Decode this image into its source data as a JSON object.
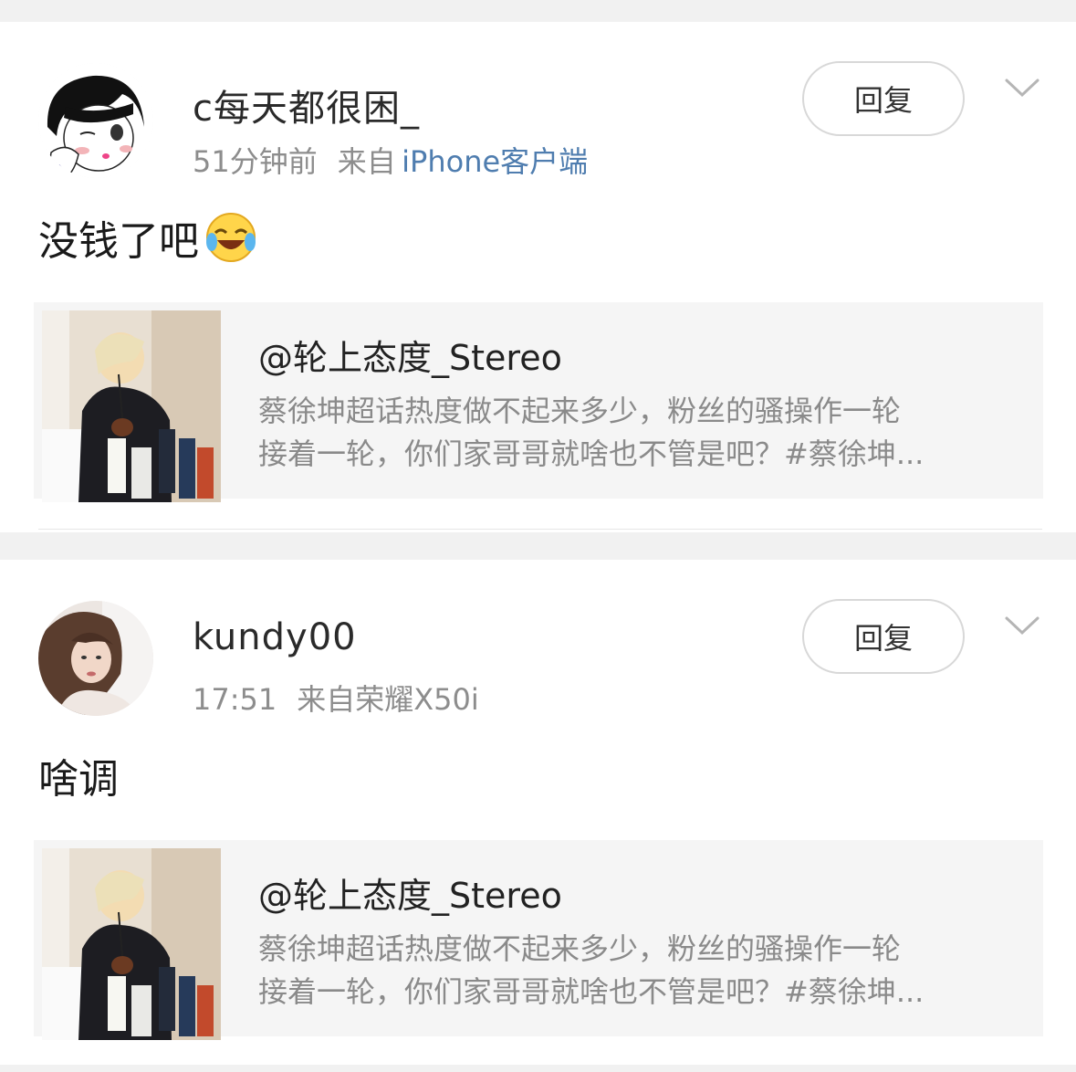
{
  "posts": [
    {
      "username": "c每天都很困_",
      "time": "51分钟前",
      "source_prefix": "来自",
      "source_link": "iPhone客户端",
      "reply_label": "回复",
      "text": "没钱了吧",
      "emoji": "laughing-crying-emoji",
      "card": {
        "title": "@轮上态度_Stereo",
        "desc_line1": "蔡徐坤超话热度做不起来多少，粉丝的骚操作一轮",
        "desc_line2": "接着一轮，你们家哥哥就啥也不管是吧？#蔡徐坤..."
      }
    },
    {
      "username": "kundy00",
      "time": "17:51",
      "source_prefix": "来自",
      "source_link": "荣耀X50i",
      "reply_label": "回复",
      "text": "啥调",
      "card": {
        "title": "@轮上态度_Stereo",
        "desc_line1": "蔡徐坤超话热度做不起来多少，粉丝的骚操作一轮",
        "desc_line2": "接着一轮，你们家哥哥就啥也不管是吧？#蔡徐坤..."
      }
    }
  ],
  "colors": {
    "link": "#4f7daf",
    "meta": "#8d8d8d",
    "card_bg": "#f5f5f5",
    "divider_bg": "#f1f1f1"
  }
}
